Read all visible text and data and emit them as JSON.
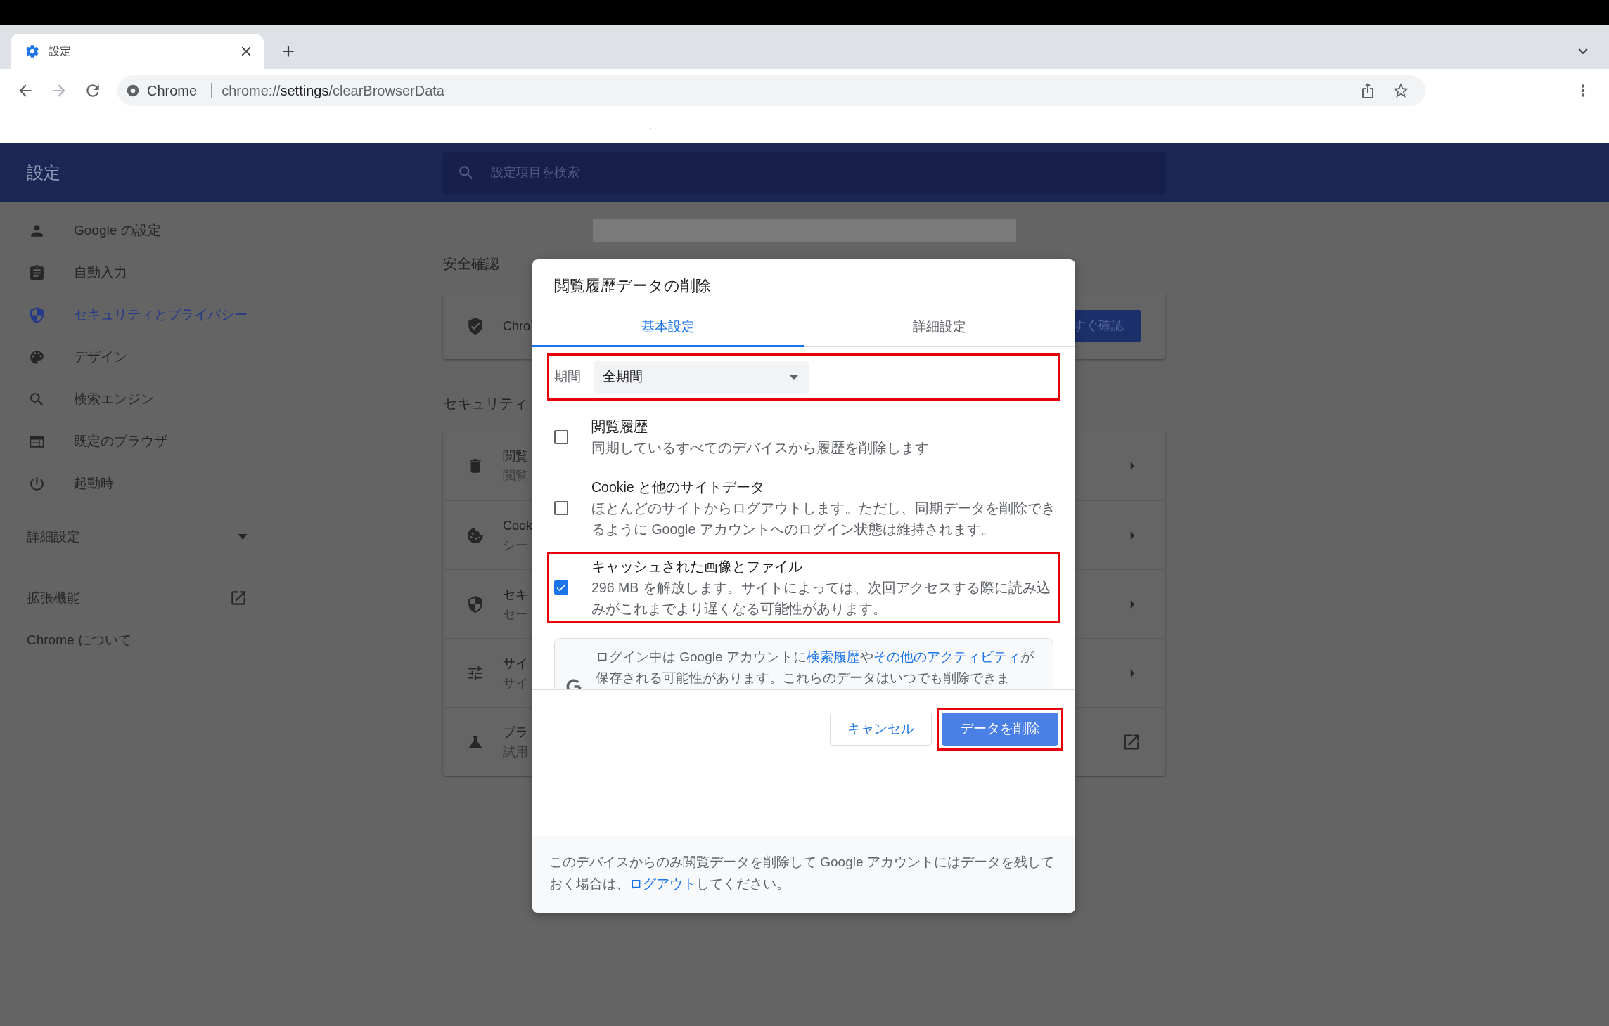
{
  "browser": {
    "tab": {
      "title": "設定"
    },
    "address": {
      "origin": "Chrome",
      "url_parts": [
        {
          "text": "chrome://",
          "emphasized": false
        },
        {
          "text": "settings",
          "emphasized": true
        },
        {
          "text": "/clearBrowserData",
          "emphasized": false
        }
      ]
    },
    "band_text": ".."
  },
  "header": {
    "title": "設定",
    "search": {
      "placeholder": "設定項目を検索"
    }
  },
  "sidebar": {
    "items": [
      {
        "label": "Google の設定",
        "selected": false
      },
      {
        "label": "自動入力",
        "selected": false
      },
      {
        "label": "セキュリティとプライバシー",
        "selected": true
      },
      {
        "label": "デザイン",
        "selected": false
      },
      {
        "label": "検索エンジン",
        "selected": false
      },
      {
        "label": "既定のブラウザ",
        "selected": false
      },
      {
        "label": "起動時",
        "selected": false
      }
    ],
    "advanced": {
      "label": "詳細設定",
      "expanded": false
    },
    "links": [
      {
        "label": "拡張機能",
        "external": true
      },
      {
        "label": "Chrome について",
        "external": false
      }
    ]
  },
  "main": {
    "sections": [
      {
        "heading": "安全確認",
        "rows": [
          {
            "kind": "action",
            "title": "Chro",
            "button": "すぐ確認"
          }
        ]
      },
      {
        "heading": "セキュリティ",
        "rows": [
          {
            "kind": "submenu",
            "title": "閲覧",
            "subtitle": "閲覧"
          },
          {
            "kind": "submenu",
            "title": "Cook",
            "subtitle": "シー"
          },
          {
            "kind": "submenu",
            "title": "セキ",
            "subtitle": "セー"
          },
          {
            "kind": "submenu",
            "title": "サイ",
            "subtitle": "サイ"
          },
          {
            "kind": "external",
            "title": "プラ",
            "subtitle": "試用"
          }
        ]
      }
    ]
  },
  "dialog": {
    "title": "閲覧履歴データの削除",
    "tabs": [
      {
        "label": "基本設定",
        "selected": true
      },
      {
        "label": "詳細設定",
        "selected": false
      }
    ],
    "period": {
      "label": "期間",
      "value": "全期間",
      "highlighted": true
    },
    "options": [
      {
        "title": "閲覧履歴",
        "description": "同期しているすべてのデバイスから履歴を削除します",
        "checked": false,
        "highlighted": false
      },
      {
        "title": "Cookie と他のサイトデータ",
        "description": "ほとんどのサイトからログアウトします。ただし、同期データを削除できるように Google アカウントへのログイン状態は維持されます。",
        "checked": false,
        "highlighted": false
      },
      {
        "title": "キャッシュされた画像とファイル",
        "description": "296 MB を解放します。サイトによっては、次回アクセスする際に読み込みがこれまでより遅くなる可能性があります。",
        "checked": true,
        "highlighted": true
      }
    ],
    "notice": {
      "segments": [
        {
          "text": "ログイン中は Google アカウントに",
          "link": false
        },
        {
          "text": "検索履歴",
          "link": true
        },
        {
          "text": "や",
          "link": false
        },
        {
          "text": "その他のアクティビティ",
          "link": true
        },
        {
          "text": "が保存される可能性があります。これらのデータはいつでも削除できま",
          "link": false
        }
      ]
    },
    "buttons": [
      {
        "label": "キャンセル",
        "kind": "secondary",
        "highlighted": false
      },
      {
        "label": "データを削除",
        "kind": "primary",
        "highlighted": true
      }
    ],
    "footer": {
      "segments": [
        {
          "text": "このデバイスからのみ閲覧データを削除して Google アカウントにはデータを残しておく場合は、",
          "link": false
        },
        {
          "text": "ログアウト",
          "link": true
        },
        {
          "text": "してください。",
          "link": false
        }
      ]
    }
  }
}
